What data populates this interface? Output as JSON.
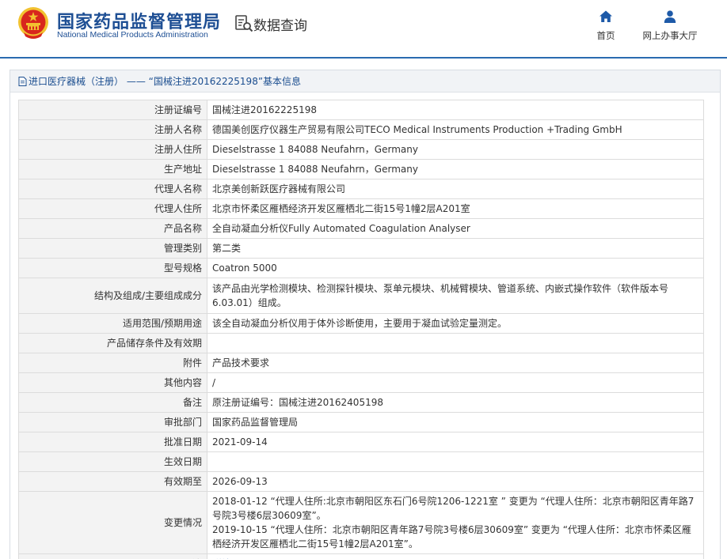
{
  "header": {
    "brand_cn": "国家药品监督管理局",
    "brand_en": "National Medical Products Administration",
    "section_title": "数据查询",
    "nav": [
      {
        "label": "首页",
        "icon": "home-icon"
      },
      {
        "label": "网上办事大厅",
        "icon": "user-icon"
      }
    ]
  },
  "card": {
    "title": "进口医疗器械（注册） —— “国械注进20162225198”基本信息"
  },
  "rows": [
    {
      "label": "注册证编号",
      "value": "国械注进20162225198"
    },
    {
      "label": "注册人名称",
      "value": "德国美创医疗仪器生产贸易有限公司TECO Medical Instruments Production +Trading GmbH"
    },
    {
      "label": "注册人住所",
      "value": "Dieselstrasse 1 84088 Neufahrn，Germany"
    },
    {
      "label": "生产地址",
      "value": "Dieselstrasse 1 84088 Neufahrn，Germany"
    },
    {
      "label": "代理人名称",
      "value": "北京美创新跃医疗器械有限公司"
    },
    {
      "label": "代理人住所",
      "value": "北京市怀柔区雁栖经济开发区雁栖北二街15号1幢2层A201室"
    },
    {
      "label": "产品名称",
      "value": "全自动凝血分析仪Fully Automated Coagulation Analyser"
    },
    {
      "label": "管理类别",
      "value": "第二类"
    },
    {
      "label": "型号规格",
      "value": "Coatron 5000"
    },
    {
      "label": "结构及组成/主要组成成分",
      "value": "该产品由光学检测模块、检测探针模块、泵单元模块、机械臂模块、管道系统、内嵌式操作软件（软件版本号 6.03.01）组成。"
    },
    {
      "label": "适用范围/预期用途",
      "value": "该全自动凝血分析仪用于体外诊断使用，主要用于凝血试验定量测定。"
    },
    {
      "label": "产品储存条件及有效期",
      "value": ""
    },
    {
      "label": "附件",
      "value": "产品技术要求"
    },
    {
      "label": "其他内容",
      "value": "/"
    },
    {
      "label": "备注",
      "value": "原注册证编号：国械注进20162405198"
    },
    {
      "label": "审批部门",
      "value": "国家药品监督管理局"
    },
    {
      "label": "批准日期",
      "value": "2021-09-14"
    },
    {
      "label": "生效日期",
      "value": ""
    },
    {
      "label": "有效期至",
      "value": "2026-09-13"
    },
    {
      "label": "变更情况",
      "value_lines": [
        "2018-01-12 “代理人住所:北京市朝阳区东石门6号院1206-1221室 ” 变更为 “代理人住所：北京市朝阳区青年路7号院3号楼6层30609室”。",
        "2019-10-15 “代理人住所：北京市朝阳区青年路7号院3号楼6层30609室” 变更为 “代理人住所：北京市怀柔区雁栖经济开发区雁栖北二街15号1幢2层A201室”。"
      ]
    },
    {
      "label": "注",
      "value": "详情"
    }
  ],
  "colors": {
    "brand": "#1e4f94",
    "link": "#1a5bb5",
    "emblem_red": "#d8261d",
    "emblem_gold": "#f2c230"
  }
}
